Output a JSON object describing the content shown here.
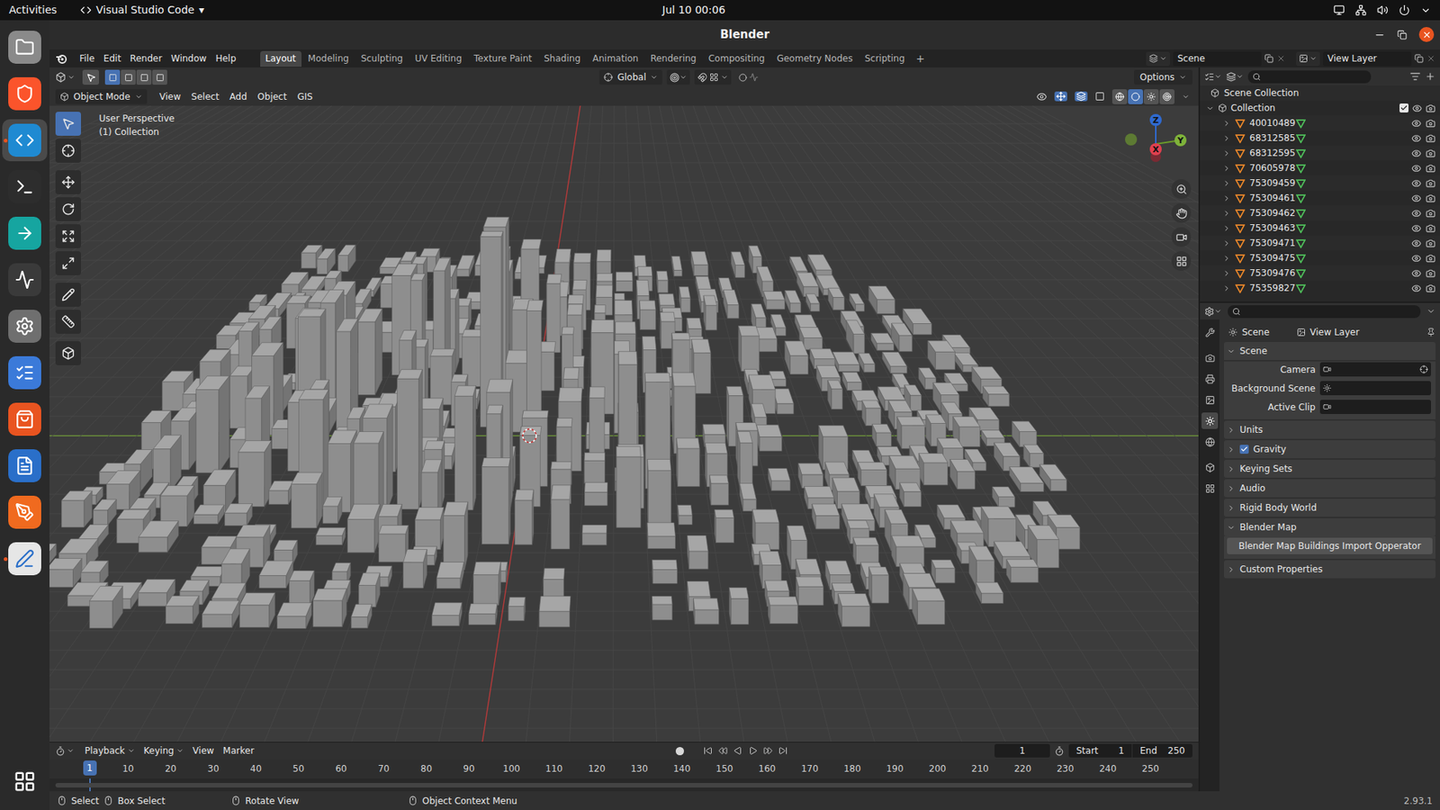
{
  "topbar": {
    "activities": "Activities",
    "app": "Visual Studio Code",
    "app_menu": "▾",
    "clock": "Jul 10  00:06"
  },
  "dock": [
    {
      "running": false,
      "selected": false
    },
    {
      "running": false,
      "selected": false
    },
    {
      "running": true,
      "selected": true
    },
    {
      "running": false,
      "selected": false
    },
    {
      "running": false,
      "selected": false
    },
    {
      "running": false,
      "selected": false
    },
    {
      "running": false,
      "selected": false
    },
    {
      "running": false,
      "selected": false
    },
    {
      "running": false,
      "selected": false
    },
    {
      "running": false,
      "selected": false
    },
    {
      "running": false,
      "selected": false
    },
    {
      "running": true,
      "selected": false
    }
  ],
  "window": {
    "title": "Blender"
  },
  "menu": [
    "File",
    "Edit",
    "Render",
    "Window",
    "Help"
  ],
  "workspaces": [
    {
      "label": "Layout",
      "selected": true
    },
    {
      "label": "Modeling",
      "selected": false
    },
    {
      "label": "Sculpting",
      "selected": false
    },
    {
      "label": "UV Editing",
      "selected": false
    },
    {
      "label": "Texture Paint",
      "selected": false
    },
    {
      "label": "Shading",
      "selected": false
    },
    {
      "label": "Animation",
      "selected": false
    },
    {
      "label": "Rendering",
      "selected": false
    },
    {
      "label": "Compositing",
      "selected": false
    },
    {
      "label": "Geometry Nodes",
      "selected": false
    },
    {
      "label": "Scripting",
      "selected": false
    }
  ],
  "add_workspace": "+",
  "scene": "Scene",
  "view_layer": "View Layer",
  "tool_header": {
    "orientation": "Global",
    "options": "Options",
    "select_modes": [
      {
        "selected": true
      },
      {
        "selected": false
      },
      {
        "selected": false
      },
      {
        "selected": false
      }
    ]
  },
  "viewport_header": {
    "mode": "Object Mode",
    "menus": [
      "View",
      "Select",
      "Add",
      "Object",
      "GIS"
    ],
    "shading": [
      {
        "selected": false
      },
      {
        "selected": true
      },
      {
        "selected": false
      },
      {
        "selected": false
      }
    ]
  },
  "viewport": {
    "perspective": "User Perspective",
    "collection": "(1) Collection",
    "gizmo": {
      "z": "Z",
      "y": "Y",
      "x": "X"
    }
  },
  "toolbar": [
    {
      "selected": true
    },
    {
      "selected": false
    },
    {
      "selected": false
    },
    {
      "selected": false
    },
    {
      "selected": false
    },
    {
      "selected": false
    },
    {
      "selected": false
    },
    {
      "selected": false
    },
    {
      "selected": false
    }
  ],
  "outliner": {
    "root": "Scene Collection",
    "collection": {
      "name": "Collection",
      "expanded": true,
      "checked": true
    },
    "objects": [
      {
        "name": "40010489",
        "expanded": false,
        "visible": true
      },
      {
        "name": "68312585",
        "expanded": false,
        "visible": true
      },
      {
        "name": "68312595",
        "expanded": false,
        "visible": true
      },
      {
        "name": "70605978",
        "expanded": false,
        "visible": true
      },
      {
        "name": "75309459",
        "expanded": false,
        "visible": true
      },
      {
        "name": "75309461",
        "expanded": false,
        "visible": true
      },
      {
        "name": "75309462",
        "expanded": false,
        "visible": true
      },
      {
        "name": "75309463",
        "expanded": false,
        "visible": true
      },
      {
        "name": "75309471",
        "expanded": false,
        "visible": true
      },
      {
        "name": "75309475",
        "expanded": false,
        "visible": true
      },
      {
        "name": "75309476",
        "expanded": false,
        "visible": true
      },
      {
        "name": "75359827",
        "expanded": false,
        "visible": true
      }
    ]
  },
  "properties": {
    "tabs": [
      {
        "selected": false
      },
      {
        "selected": false
      },
      {
        "selected": false
      },
      {
        "selected": false
      },
      {
        "selected": true
      },
      {
        "selected": false
      },
      {
        "selected": false
      },
      {
        "selected": false
      }
    ],
    "breadcrumb": [
      "Scene",
      "View Layer"
    ],
    "scene_section": {
      "title": "Scene",
      "expanded": true,
      "fields": [
        {
          "label": "Camera"
        },
        {
          "label": "Background Scene"
        },
        {
          "label": "Active Clip"
        }
      ]
    },
    "panels": [
      {
        "title": "Units",
        "kind": "panel",
        "expanded": false
      },
      {
        "title": "Gravity",
        "kind": "checkbox",
        "expanded": false,
        "checked": true
      },
      {
        "title": "Keying Sets",
        "kind": "panel",
        "expanded": false
      },
      {
        "title": "Audio",
        "kind": "panel",
        "expanded": false
      },
      {
        "title": "Rigid Body World",
        "kind": "panel",
        "expanded": false
      },
      {
        "title": "Blender Map",
        "kind": "panel",
        "expanded": true,
        "button": "Blender Map Buildings Import Opperator"
      },
      {
        "title": "Custom Properties",
        "kind": "panel",
        "expanded": false
      }
    ]
  },
  "timeline": {
    "menus": [
      "Playback",
      "Keying",
      "View",
      "Marker"
    ],
    "current_frame": "1",
    "start_label": "Start",
    "start": "1",
    "end_label": "End",
    "end": "250",
    "playhead": "1",
    "ticks": [
      "10",
      "20",
      "30",
      "40",
      "50",
      "60",
      "70",
      "80",
      "90",
      "100",
      "110",
      "120",
      "130",
      "140",
      "150",
      "160",
      "170",
      "180",
      "190",
      "200",
      "210",
      "220",
      "230",
      "240",
      "250"
    ]
  },
  "status_bar": {
    "items": [
      "Select",
      "Box Select",
      "Rotate View",
      "Object Context Menu"
    ],
    "version": "2.93.1"
  }
}
